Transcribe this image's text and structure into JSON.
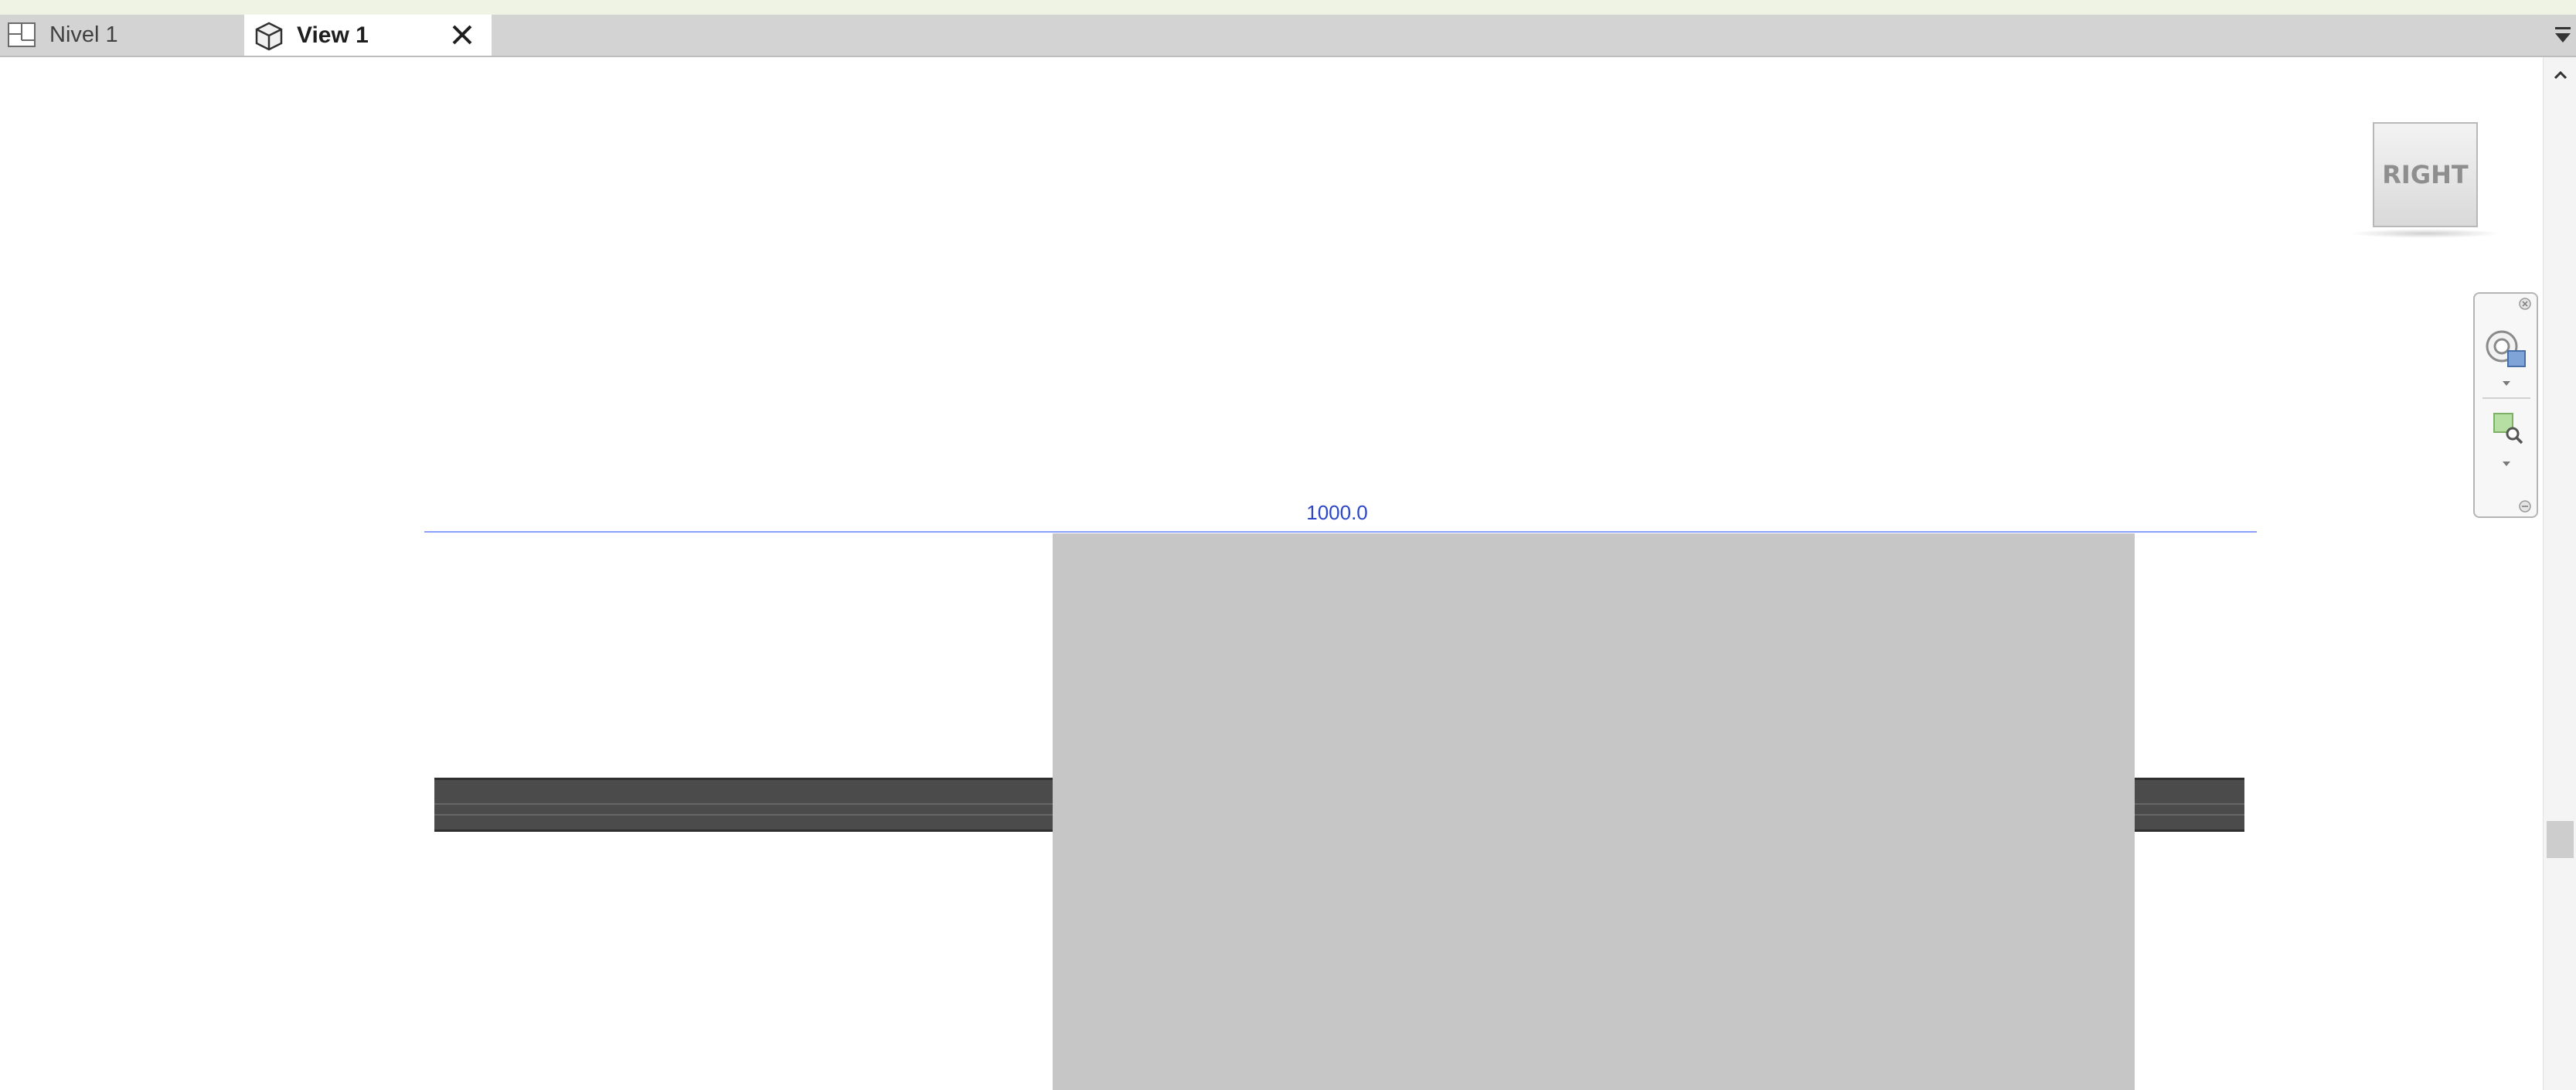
{
  "tabs": [
    {
      "label": "Nivel 1",
      "icon": "floor-plan-icon",
      "active": false
    },
    {
      "label": "View 1",
      "icon": "3d-view-icon",
      "active": true
    }
  ],
  "active_tab_close_icon": "close-icon",
  "tab_overflow_icon": "tab-menu-icon",
  "level": {
    "label": "1000.0",
    "color": "#2d46c8",
    "line_color": "#8aa0ff"
  },
  "viewcube": {
    "face": "RIGHT"
  },
  "navigation_bar": {
    "items": [
      "steering-wheel-icon",
      "zoom-icon"
    ],
    "controls": [
      "close-icon",
      "options-icon"
    ]
  },
  "colors": {
    "beam": "#4b4b4b",
    "column": "#c6c6c6",
    "tab_bar": "#d3d3d3",
    "top_strip": "#eef3e4"
  }
}
